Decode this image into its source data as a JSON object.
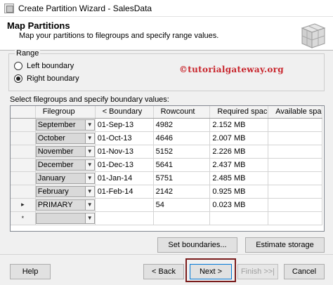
{
  "window": {
    "title": "Create Partition Wizard - SalesData"
  },
  "header": {
    "title": "Map Partitions",
    "subtitle": "Map your partitions to filegroups and specify range values."
  },
  "range": {
    "legend": "Range",
    "options": [
      {
        "label": "Left boundary",
        "checked": false
      },
      {
        "label": "Right boundary",
        "checked": true
      }
    ]
  },
  "watermark": "©tutorialgateway.org",
  "grid": {
    "label": "Select filegroups and specify boundary values:",
    "columns": [
      "Filegroup",
      "< Boundary",
      "Rowcount",
      "Required space",
      "Available space"
    ],
    "rows": [
      {
        "marker": "",
        "filegroup": "September",
        "boundary": "01-Sep-13",
        "rowcount": "4982",
        "required": "2.152 MB",
        "available": ""
      },
      {
        "marker": "",
        "filegroup": "October",
        "boundary": "01-Oct-13",
        "rowcount": "4646",
        "required": "2.007 MB",
        "available": ""
      },
      {
        "marker": "",
        "filegroup": "November",
        "boundary": "01-Nov-13",
        "rowcount": "5152",
        "required": "2.226 MB",
        "available": ""
      },
      {
        "marker": "",
        "filegroup": "December",
        "boundary": "01-Dec-13",
        "rowcount": "5641",
        "required": "2.437 MB",
        "available": ""
      },
      {
        "marker": "",
        "filegroup": "January",
        "boundary": "01-Jan-14",
        "rowcount": "5751",
        "required": "2.485 MB",
        "available": ""
      },
      {
        "marker": "",
        "filegroup": "February",
        "boundary": "01-Feb-14",
        "rowcount": "2142",
        "required": "0.925 MB",
        "available": ""
      },
      {
        "marker": "▸",
        "filegroup": "PRIMARY",
        "boundary": "",
        "rowcount": "54",
        "required": "0.023 MB",
        "available": ""
      },
      {
        "marker": "*",
        "filegroup": "",
        "boundary": "",
        "rowcount": "",
        "required": "",
        "available": ""
      }
    ]
  },
  "buttons": {
    "set_boundaries": "Set boundaries...",
    "estimate_storage": "Estimate storage",
    "help": "Help",
    "back": "< Back",
    "next": "Next >",
    "finish": "Finish >>|",
    "cancel": "Cancel"
  },
  "colors": {
    "watermark": "#c8252c",
    "highlight": "#7a1c1c"
  }
}
